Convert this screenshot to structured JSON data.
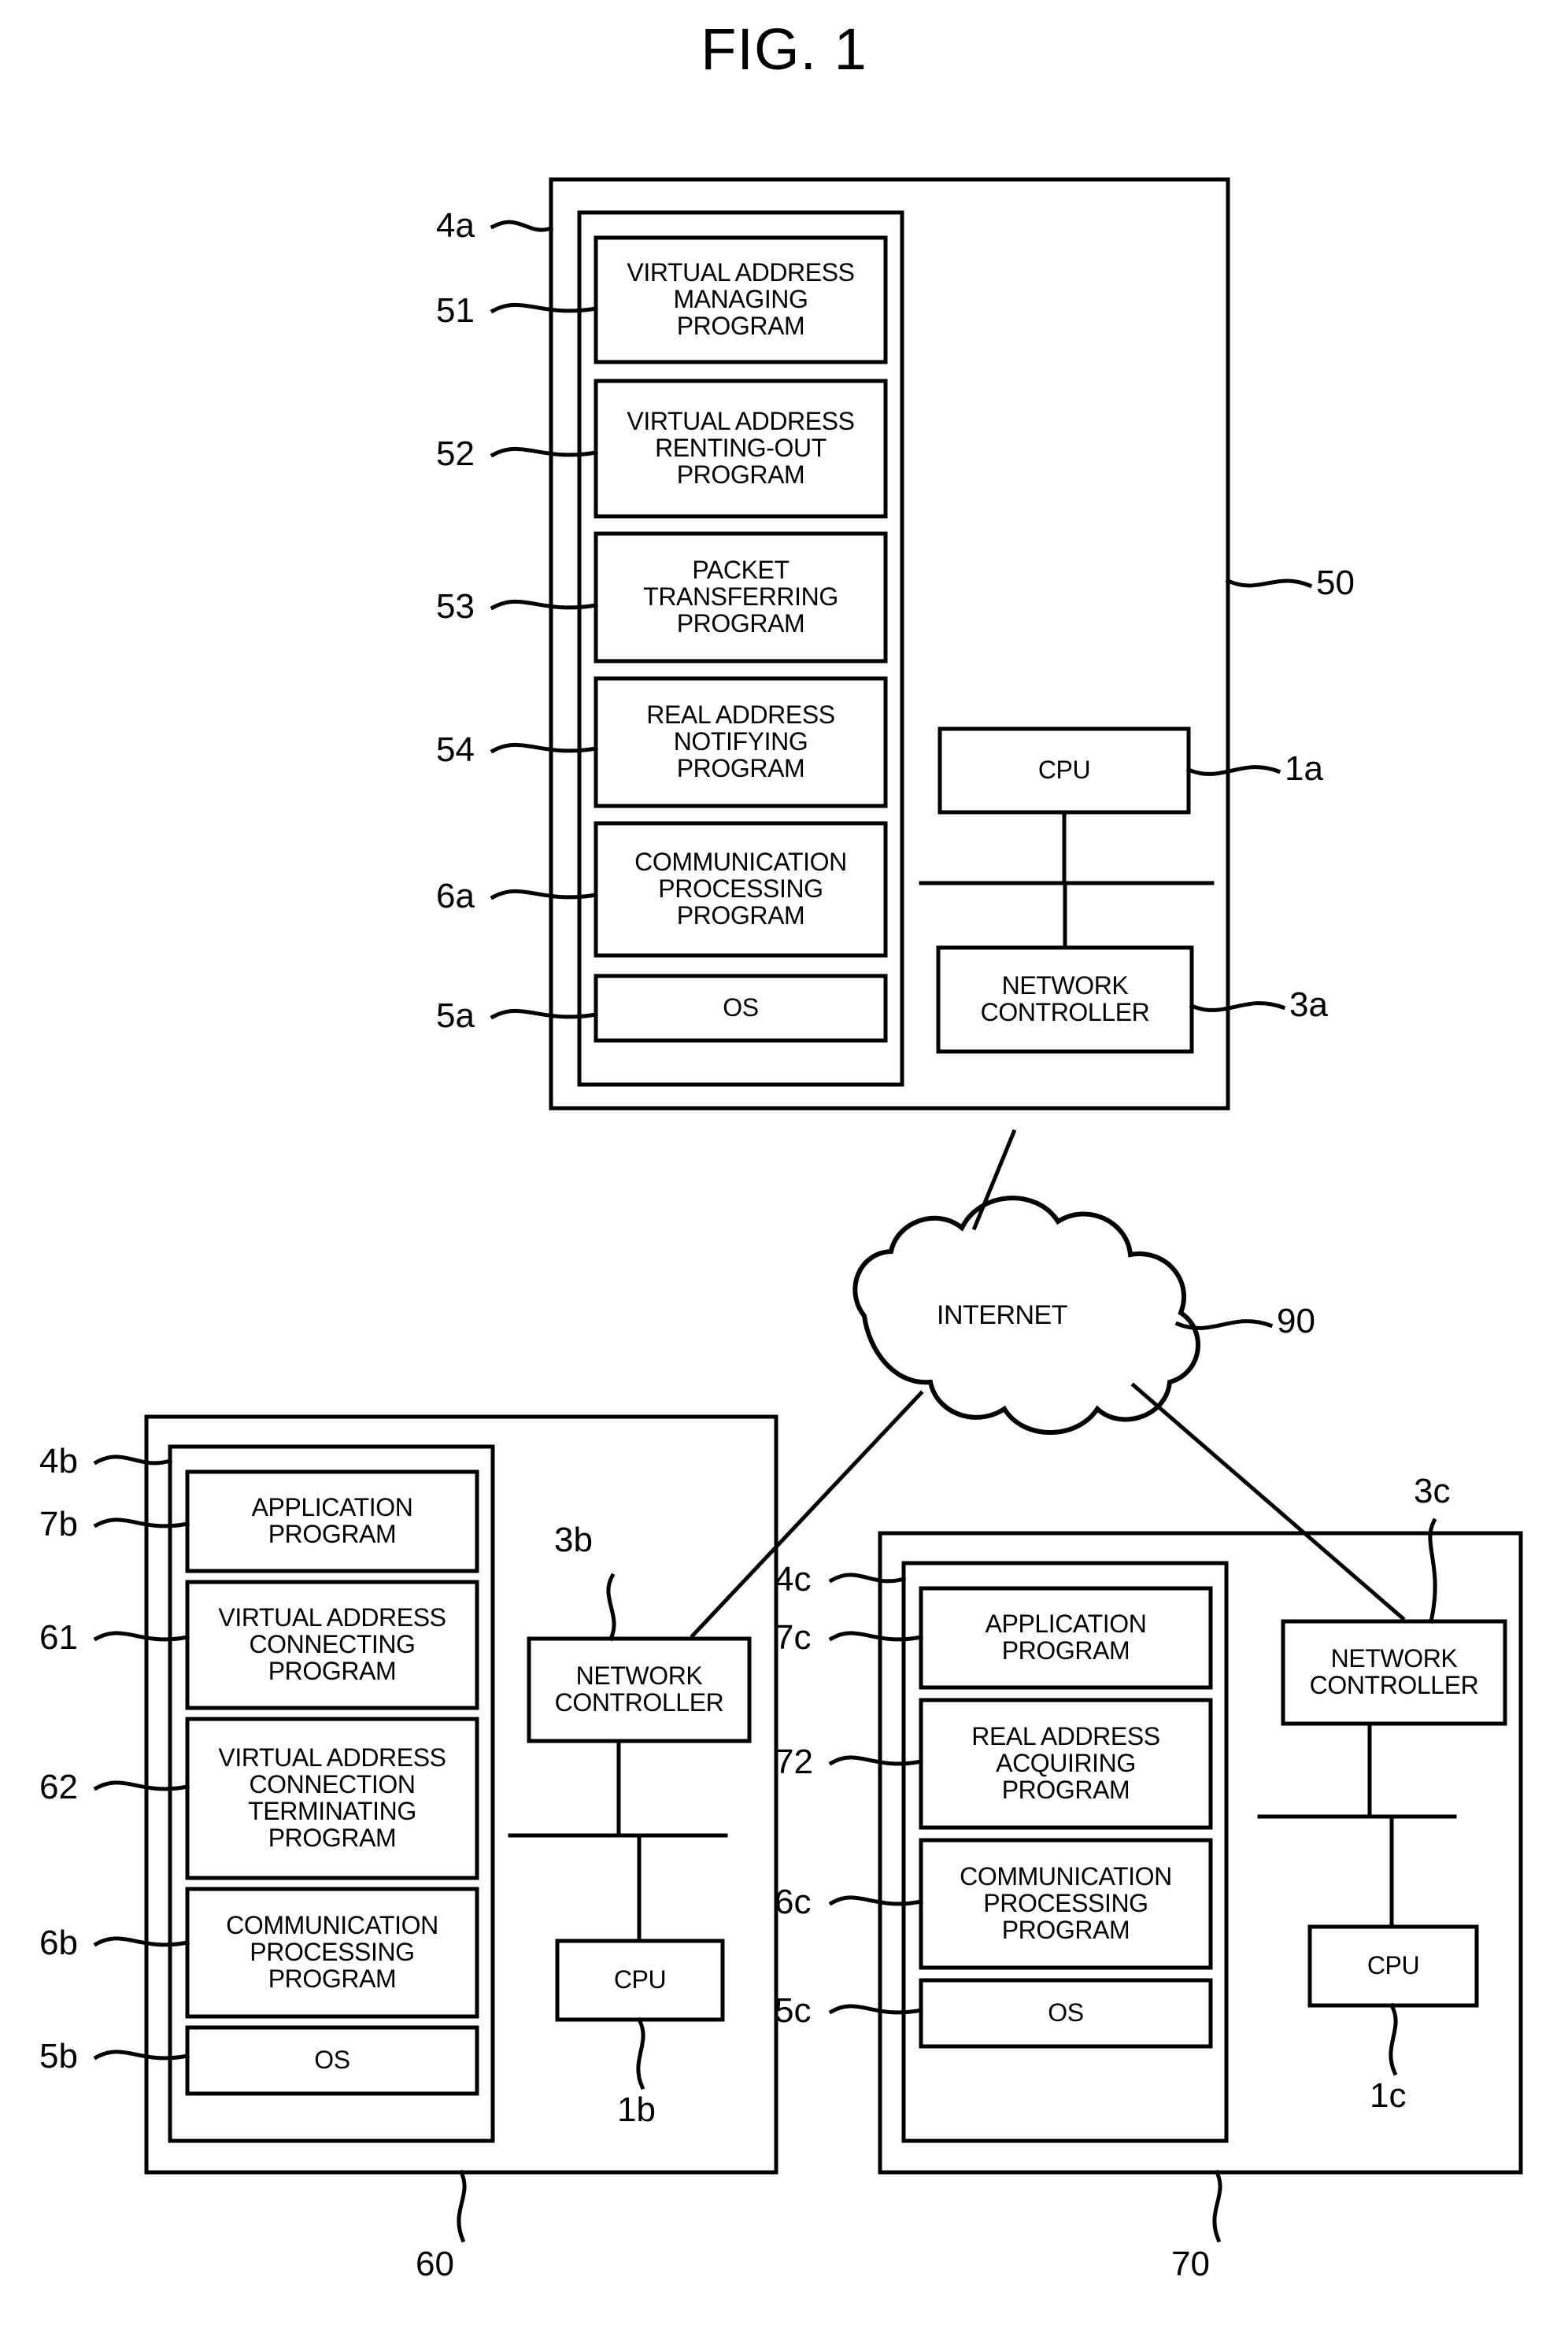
{
  "figure": {
    "title": "FIG. 1"
  },
  "network": {
    "cloud_label": "INTERNET",
    "cloud_ref": "90"
  },
  "devices": [
    {
      "id": "device-top",
      "outer_ref": "50",
      "memory_ref": "4a",
      "cpu_label": "CPU",
      "cpu_ref": "1a",
      "nic_label": "NETWORK CONTROLLER",
      "nic_label_line1": "NETWORK",
      "nic_label_line2": "CONTROLLER",
      "nic_ref": "3a",
      "programs": [
        {
          "ref": "51",
          "lines": [
            "VIRTUAL ADDRESS",
            "MANAGING",
            "PROGRAM"
          ]
        },
        {
          "ref": "52",
          "lines": [
            "VIRTUAL ADDRESS",
            "RENTING-OUT",
            "PROGRAM"
          ]
        },
        {
          "ref": "53",
          "lines": [
            "PACKET",
            "TRANSFERRING",
            "PROGRAM"
          ]
        },
        {
          "ref": "54",
          "lines": [
            "REAL ADDRESS",
            "NOTIFYING",
            "PROGRAM"
          ]
        },
        {
          "ref": "6a",
          "lines": [
            "COMMUNICATION",
            "PROCESSING",
            "PROGRAM"
          ]
        },
        {
          "ref": "5a",
          "lines": [
            "OS"
          ]
        }
      ]
    },
    {
      "id": "device-bottom-left",
      "outer_ref": "60",
      "memory_ref": "4b",
      "cpu_label": "CPU",
      "cpu_ref": "1b",
      "nic_label": "NETWORK CONTROLLER",
      "nic_label_line1": "NETWORK",
      "nic_label_line2": "CONTROLLER",
      "nic_ref": "3b",
      "programs": [
        {
          "ref": "7b",
          "lines": [
            "APPLICATION",
            "PROGRAM"
          ]
        },
        {
          "ref": "61",
          "lines": [
            "VIRTUAL ADDRESS",
            "CONNECTING",
            "PROGRAM"
          ]
        },
        {
          "ref": "62",
          "lines": [
            "VIRTUAL ADDRESS",
            "CONNECTION",
            "TERMINATING",
            "PROGRAM"
          ]
        },
        {
          "ref": "6b",
          "lines": [
            "COMMUNICATION",
            "PROCESSING",
            "PROGRAM"
          ]
        },
        {
          "ref": "5b",
          "lines": [
            "OS"
          ]
        }
      ]
    },
    {
      "id": "device-bottom-right",
      "outer_ref": "70",
      "memory_ref": "4c",
      "cpu_label": "CPU",
      "cpu_ref": "1c",
      "nic_label": "NETWORK CONTROLLER",
      "nic_label_line1": "NETWORK",
      "nic_label_line2": "CONTROLLER",
      "nic_ref": "3c",
      "programs": [
        {
          "ref": "7c",
          "lines": [
            "APPLICATION",
            "PROGRAM"
          ]
        },
        {
          "ref": "72",
          "lines": [
            "REAL ADDRESS",
            "ACQUIRING",
            "PROGRAM"
          ]
        },
        {
          "ref": "6c",
          "lines": [
            "COMMUNICATION",
            "PROCESSING",
            "PROGRAM"
          ]
        },
        {
          "ref": "5c",
          "lines": [
            "OS"
          ]
        }
      ]
    }
  ]
}
